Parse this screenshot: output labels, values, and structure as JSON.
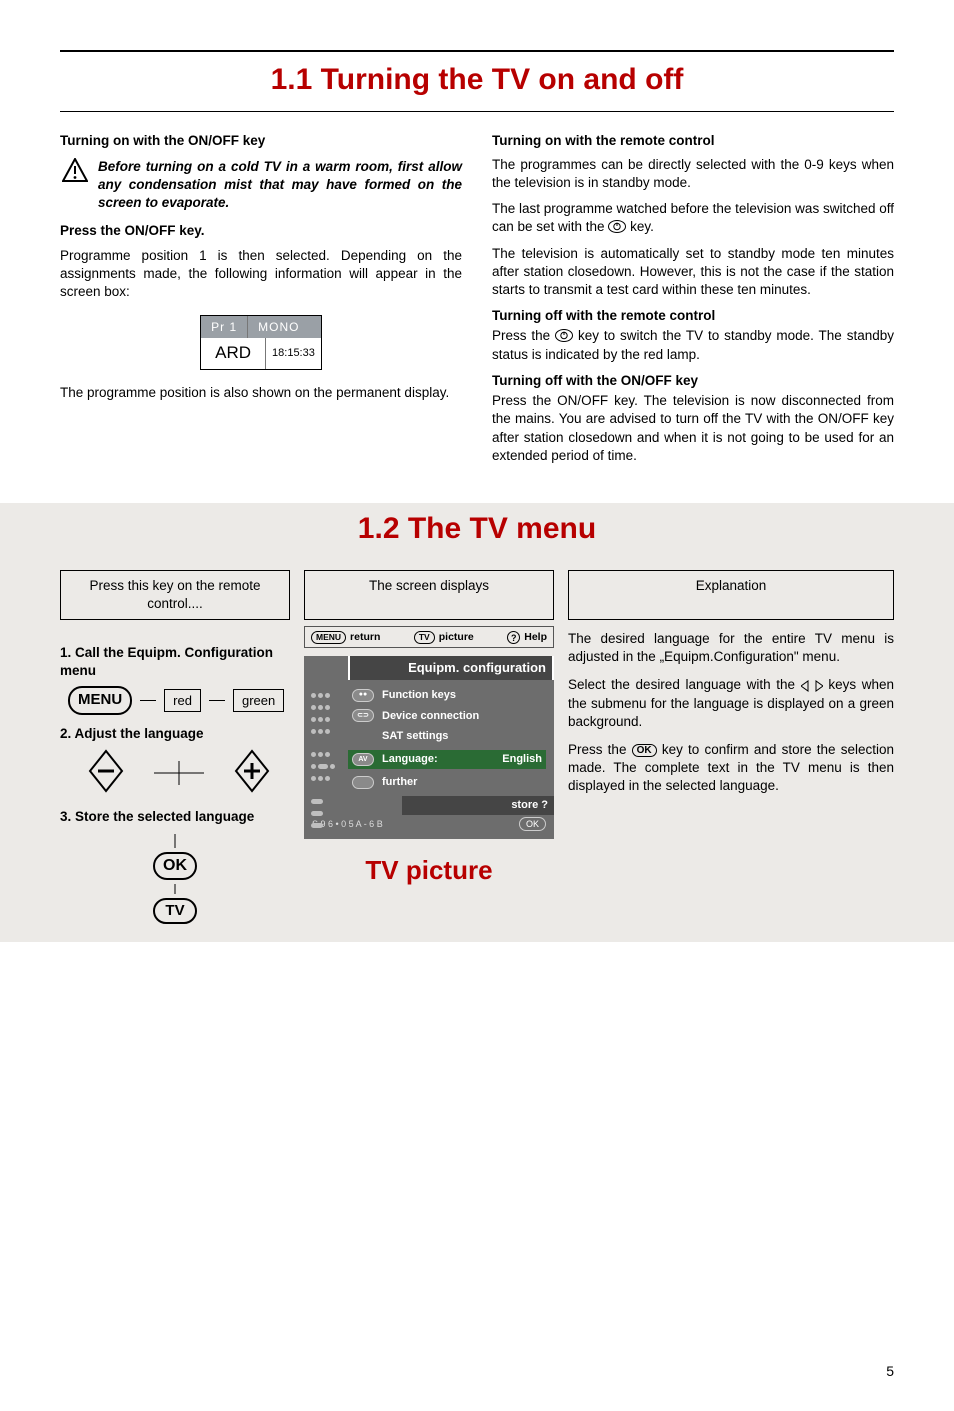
{
  "section11": {
    "title": "1.1 Turning the TV on and off",
    "left": {
      "h1": "Turning on with the ON/OFF key",
      "warning": "Before turning on a cold TV in a warm room, first allow any condensation mist that may have formed on the screen to evaporate.",
      "h2": "Press the ON/OFF key.",
      "p1": "Programme position 1 is then selected. Depending on the assignments made, the following information will appear in the screen box:",
      "screenbox": {
        "pr": "Pr  1",
        "mode": "MONO",
        "channel": "ARD",
        "time": "18:15:33"
      },
      "p2": "The programme position is also shown on the permanent display."
    },
    "right": {
      "h1": "Turning on with the remote control",
      "p1": "The programmes can be directly selected with the 0-9 keys when the television is in standby mode.",
      "p2a": "The last programme watched before the television was switched off can be set with the ",
      "p2b": " key.",
      "p3": "The television is automatically set to standby mode ten minutes after station closedown. However, this is not the case if the station starts to transmit a test card within these ten minutes.",
      "h2": "Turning off with the remote control",
      "p4a": "Press the ",
      "p4b": " key to switch the TV to standby mode. The standby status is indicated by the red lamp.",
      "h3": "Turning off with the ON/OFF key",
      "p5": "Press the ON/OFF key. The television is now disconnected from the mains. You are advised to turn off the TV with the ON/OFF key after station closedown and when it is not going to be used for an extended period of time."
    }
  },
  "section12": {
    "title": "1.2 The TV menu",
    "headers": {
      "left": "Press this key on the remote control....",
      "mid": "The screen displays",
      "right": "Explanation"
    },
    "left": {
      "step1": "1. Call the Equipm. Configuration menu",
      "menu": "MENU",
      "red": "red",
      "green": "green",
      "step2": "2. Adjust the language",
      "step3": "3. Store the selected language",
      "ok": "OK",
      "tv": "TV"
    },
    "mid": {
      "bar": {
        "return": "return",
        "returnKey": "MENU",
        "picture": "picture",
        "pictureKey": "TV",
        "help": "Help",
        "helpKey": "?"
      },
      "osd_title": "Equipm. configuration",
      "item_func": "Function keys",
      "item_dev": "Device connection",
      "item_sat": "SAT settings",
      "item_lang_label": "Language:",
      "item_lang_value": "English",
      "item_langKey": "AV",
      "item_further": "further",
      "store": "store ?",
      "model": "S 9 6 • 0 5 A - 6 B",
      "okmini": "OK"
    },
    "right": {
      "p1": "The desired language for the entire TV menu is adjusted in the „Equipm.Configuration\" menu.",
      "p2a": "Select the desired language with the ",
      "p2b": " keys when the submenu for the language is displayed on a green background.",
      "p3a": "Press the ",
      "p3b": " key to confirm and store the selection made. The complete text in the TV menu is then displayed in the selected language.",
      "okinline": "OK"
    },
    "tv_picture": "TV picture"
  },
  "pageNumber": "5"
}
